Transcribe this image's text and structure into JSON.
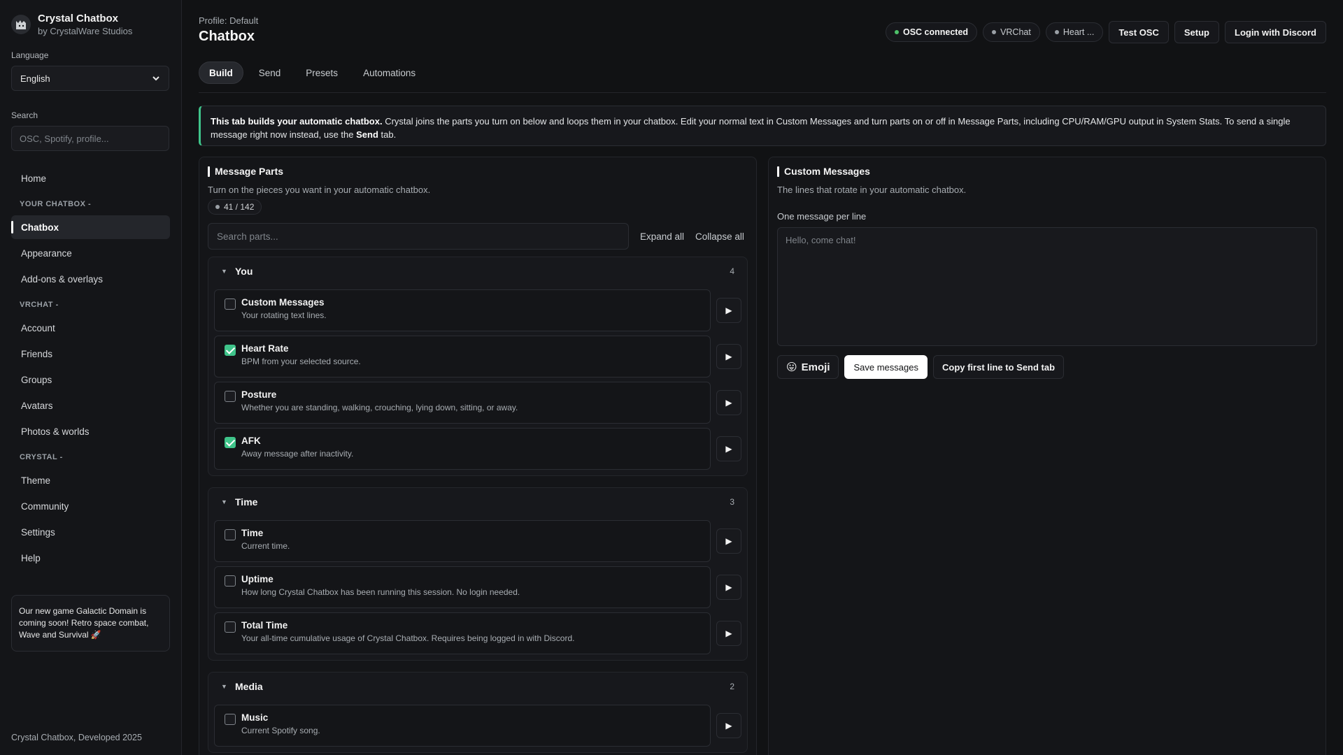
{
  "sidebar": {
    "brand_title": "Crystal Chatbox",
    "brand_sub": "by CrystalWare Studios",
    "language_label": "Language",
    "language_value": "English",
    "search_label": "Search",
    "search_placeholder": "OSC, Spotify, profile...",
    "home": "Home",
    "section_chatbox": "YOUR CHATBOX -",
    "chatbox": "Chatbox",
    "appearance": "Appearance",
    "addons": "Add-ons & overlays",
    "section_vrchat": "VRCHAT -",
    "account": "Account",
    "friends": "Friends",
    "groups": "Groups",
    "avatars": "Avatars",
    "photos": "Photos & worlds",
    "section_crystal": "CRYSTAL -",
    "theme": "Theme",
    "community": "Community",
    "settings": "Settings",
    "help": "Help",
    "promo": "Our new game Galactic Domain is coming soon! Retro space combat, Wave and Survival 🚀",
    "footer": "Crystal Chatbox, Developed 2025"
  },
  "header": {
    "profile": "Profile: Default",
    "title": "Chatbox",
    "osc_status": "OSC connected",
    "vrchat_status": "VRChat",
    "heart_status": "Heart ...",
    "test_osc": "Test OSC",
    "setup": "Setup",
    "login": "Login with Discord"
  },
  "tabs": {
    "build": "Build",
    "send": "Send",
    "presets": "Presets",
    "automations": "Automations"
  },
  "info": {
    "bold": "This tab builds your automatic chatbox.",
    "text1": " Crystal joins the parts you turn on below and loops them in your chatbox. Edit your normal text in Custom Messages and turn parts on or off in Message Parts, including CPU/RAM/GPU output in System Stats. To send a single message right now instead, use the ",
    "send_word": "Send",
    "text2": " tab."
  },
  "parts": {
    "title": "Message Parts",
    "subtitle": "Turn on the pieces you want in your automatic chatbox.",
    "count": "41 / 142",
    "search_placeholder": "Search parts...",
    "expand_all": "Expand all",
    "collapse_all": "Collapse all",
    "groups": [
      {
        "name": "You",
        "count": "4",
        "items": [
          {
            "title": "Custom Messages",
            "desc": "Your rotating text lines.",
            "checked": false
          },
          {
            "title": "Heart Rate",
            "desc": "BPM from your selected source.",
            "checked": true
          },
          {
            "title": "Posture",
            "desc": "Whether you are standing, walking, crouching, lying down, sitting, or away.",
            "checked": false
          },
          {
            "title": "AFK",
            "desc": "Away message after inactivity.",
            "checked": true
          }
        ]
      },
      {
        "name": "Time",
        "count": "3",
        "items": [
          {
            "title": "Time",
            "desc": "Current time.",
            "checked": false
          },
          {
            "title": "Uptime",
            "desc": "How long Crystal Chatbox has been running this session. No login needed.",
            "checked": false
          },
          {
            "title": "Total Time",
            "desc": "Your all-time cumulative usage of Crystal Chatbox. Requires being logged in with Discord.",
            "checked": false
          }
        ]
      },
      {
        "name": "Media",
        "count": "2",
        "items": [
          {
            "title": "Music",
            "desc": "Current Spotify song.",
            "checked": false
          }
        ]
      }
    ]
  },
  "messages": {
    "title": "Custom Messages",
    "subtitle": "The lines that rotate in your automatic chatbox.",
    "field_label": "One message per line",
    "placeholder": "Hello, come chat!",
    "emoji_btn": "Emoji",
    "save_btn": "Save messages",
    "copy_btn": "Copy first line to Send tab"
  },
  "colors": {
    "accent": "#3fc48a",
    "background": "#111214"
  }
}
